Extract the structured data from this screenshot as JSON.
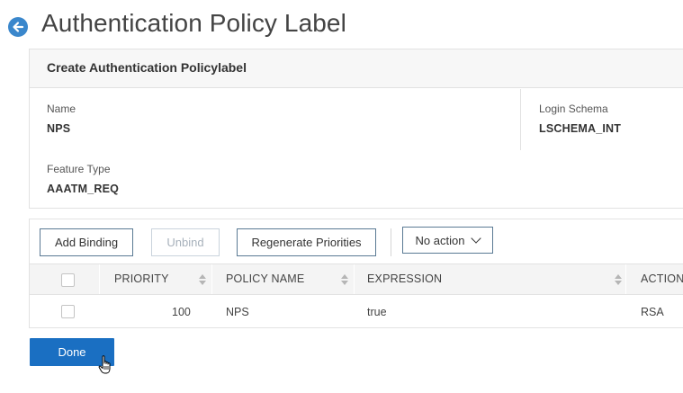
{
  "header": {
    "title": "Authentication Policy Label",
    "back_icon": "arrow-left-icon"
  },
  "form": {
    "panel_title": "Create Authentication Policylabel",
    "fields": [
      {
        "label": "Name",
        "value": "NPS"
      },
      {
        "label": "Login Schema",
        "value": "LSCHEMA_INT"
      },
      {
        "label": "Feature Type",
        "value": "AAATM_REQ"
      }
    ]
  },
  "toolbar": {
    "add_binding": "Add Binding",
    "unbind": "Unbind",
    "regenerate": "Regenerate Priorities",
    "action_select": "No action"
  },
  "table": {
    "columns": [
      "PRIORITY",
      "POLICY NAME",
      "EXPRESSION",
      "ACTION"
    ],
    "rows": [
      {
        "priority": "100",
        "policy_name": "NPS",
        "expression": "true",
        "action": "RSA"
      }
    ]
  },
  "footer": {
    "done": "Done"
  },
  "colors": {
    "accent": "#1a6fc2",
    "back_icon": "#3a87cc"
  }
}
